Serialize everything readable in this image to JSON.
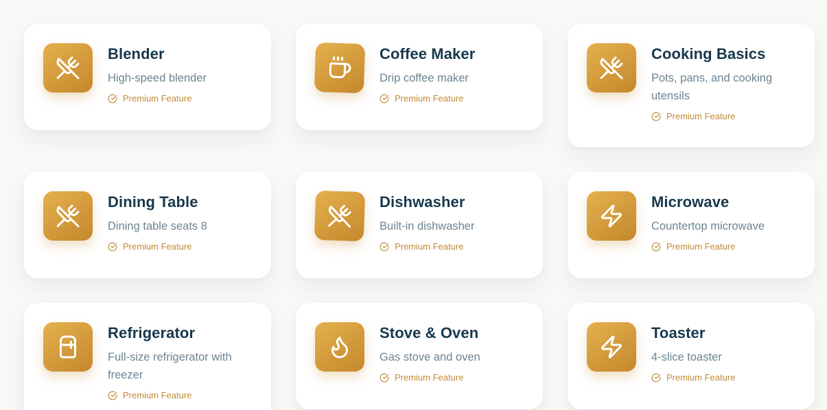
{
  "amenities": [
    {
      "title": "Blender",
      "description": "High-speed blender",
      "badge": "Premium Feature",
      "icon": "utensils-crossed-icon"
    },
    {
      "title": "Coffee Maker",
      "description": "Drip coffee maker",
      "badge": "Premium Feature",
      "icon": "coffee-cup-icon"
    },
    {
      "title": "Cooking Basics",
      "description": "Pots, pans, and cooking utensils",
      "badge": "Premium Feature",
      "icon": "utensils-crossed-icon"
    },
    {
      "title": "Dining Table",
      "description": "Dining table seats 8",
      "badge": "Premium Feature",
      "icon": "utensils-crossed-icon"
    },
    {
      "title": "Dishwasher",
      "description": "Built-in dishwasher",
      "badge": "Premium Feature",
      "icon": "utensils-crossed-icon"
    },
    {
      "title": "Microwave",
      "description": "Countertop microwave",
      "badge": "Premium Feature",
      "icon": "lightning-bolt-icon"
    },
    {
      "title": "Refrigerator",
      "description": "Full-size refrigerator with freezer",
      "badge": "Premium Feature",
      "icon": "refrigerator-icon"
    },
    {
      "title": "Stove & Oven",
      "description": "Gas stove and oven",
      "badge": "Premium Feature",
      "icon": "flame-icon"
    },
    {
      "title": "Toaster",
      "description": "4-slice toaster",
      "badge": "Premium Feature",
      "icon": "lightning-bolt-icon"
    }
  ],
  "colors": {
    "accent_gold": "#d29a3b",
    "title_navy": "#17384d",
    "desc_slate": "#6b8492",
    "badge_gold": "#c08a36"
  }
}
